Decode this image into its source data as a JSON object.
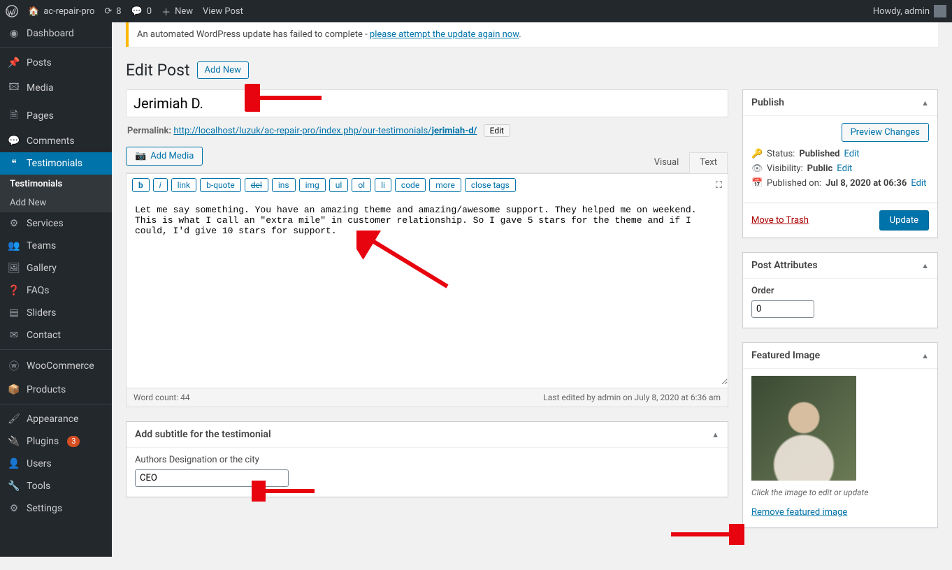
{
  "adminbar": {
    "site_name": "ac-repair-pro",
    "updates_count": "8",
    "comments_count": "0",
    "new_label": "New",
    "view_post_label": "View Post",
    "howdy": "Howdy, admin"
  },
  "sidebar": {
    "dashboard": "Dashboard",
    "posts": "Posts",
    "media": "Media",
    "pages": "Pages",
    "comments": "Comments",
    "testimonials": "Testimonials",
    "sub_testimonials": "Testimonials",
    "sub_add_new": "Add New",
    "services": "Services",
    "teams": "Teams",
    "gallery": "Gallery",
    "faqs": "FAQs",
    "sliders": "Sliders",
    "contact": "Contact",
    "woocommerce": "WooCommerce",
    "products": "Products",
    "appearance": "Appearance",
    "plugins": "Plugins",
    "plugins_badge": "3",
    "users": "Users",
    "tools": "Tools",
    "settings": "Settings"
  },
  "notice": {
    "text_before": "An automated WordPress update has failed to complete - ",
    "link": "please attempt the update again now",
    "text_after": "."
  },
  "heading": {
    "title": "Edit Post",
    "add_new": "Add New"
  },
  "post": {
    "title": "Jerimiah D.",
    "permalink_label": "Permalink:",
    "permalink_base": "http://localhost/luzuk/ac-repair-pro/index.php/our-testimonials/",
    "permalink_slug": "jerimiah-d/",
    "permalink_edit": "Edit",
    "add_media": "Add Media",
    "tabs": {
      "visual": "Visual",
      "text": "Text"
    },
    "quicktags": [
      "b",
      "i",
      "link",
      "b-quote",
      "del",
      "ins",
      "img",
      "ul",
      "ol",
      "li",
      "code",
      "more",
      "close tags"
    ],
    "content": "Let me say something. You have an amazing theme and amazing/awesome support. They helped me on weekend. This is what I call an \"extra mile\" in customer relationship. So I gave 5 stars for the theme and if I could, I'd give 10 stars for support.",
    "word_count_label": "Word count: 44",
    "last_edited": "Last edited by admin on July 8, 2020 at 6:36 am"
  },
  "subtitle_box": {
    "title": "Add subtitle for the testimonial",
    "label": "Authors Designation or the city",
    "value": "CEO"
  },
  "publish": {
    "title": "Publish",
    "preview": "Preview Changes",
    "status_label": "Status:",
    "status_value": "Published",
    "visibility_label": "Visibility:",
    "visibility_value": "Public",
    "published_label": "Published on:",
    "published_value": "Jul 8, 2020 at 06:36",
    "edit": "Edit",
    "trash": "Move to Trash",
    "update": "Update"
  },
  "attributes": {
    "title": "Post Attributes",
    "order_label": "Order",
    "order_value": "0"
  },
  "featured": {
    "title": "Featured Image",
    "hint": "Click the image to edit or update",
    "remove": "Remove featured image"
  }
}
